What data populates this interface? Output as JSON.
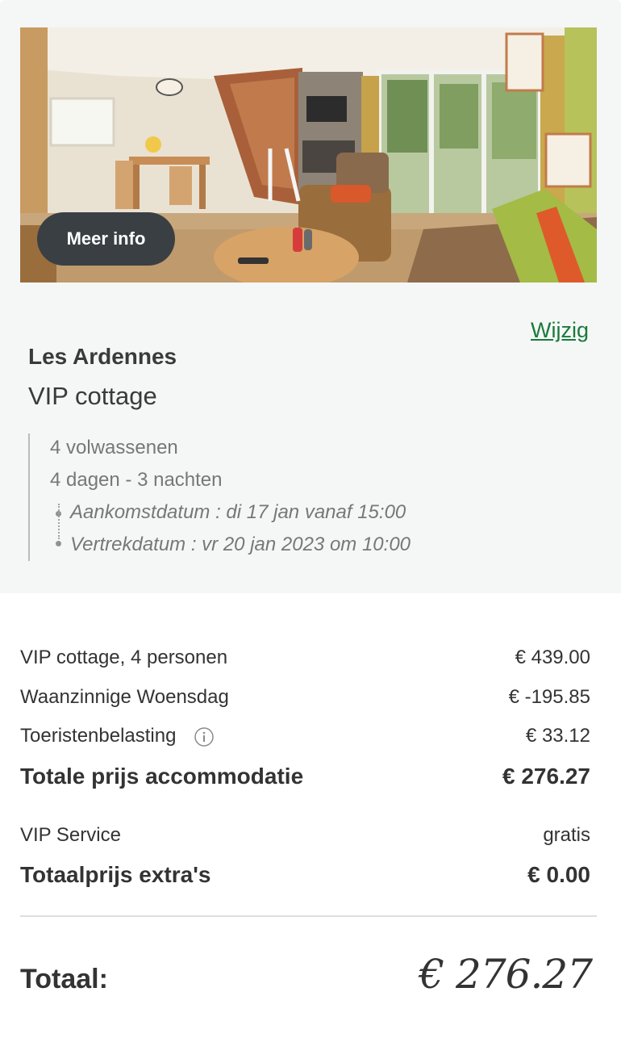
{
  "photo": {
    "alt_icon": "cottage-interior-photo"
  },
  "buttons": {
    "meer_info": "Meer info",
    "wijzig": "Wijzig"
  },
  "booking": {
    "park": "Les Ardennes",
    "accommodation": "VIP cottage",
    "guests": "4 volwassenen",
    "duration": "4 dagen - 3 nachten",
    "arrival": "Aankomstdatum : di 17 jan vanaf 15:00",
    "departure": "Vertrekdatum : vr 20 jan 2023 om 10:00"
  },
  "price_lines": [
    {
      "label": "VIP cottage, 4 personen",
      "value": "€ 439.00"
    },
    {
      "label": "Waanzinnige Woensdag",
      "value": "€ -195.85"
    },
    {
      "label": "Toeristenbelasting",
      "value": "€ 33.12",
      "icon": "info-icon"
    }
  ],
  "accommodation_total": {
    "label": "Totale prijs accommodatie",
    "value": "€ 276.27"
  },
  "extras": [
    {
      "label": "VIP Service",
      "value": "gratis"
    }
  ],
  "extras_total": {
    "label": "Totaalprijs extra's",
    "value": "€ 0.00"
  },
  "grand_total": {
    "label": "Totaal:",
    "value": "€ 276.27"
  },
  "colors": {
    "link": "#1a7a3a",
    "button_bg": "#3a3f44",
    "panel_bg": "#f5f7f6"
  }
}
